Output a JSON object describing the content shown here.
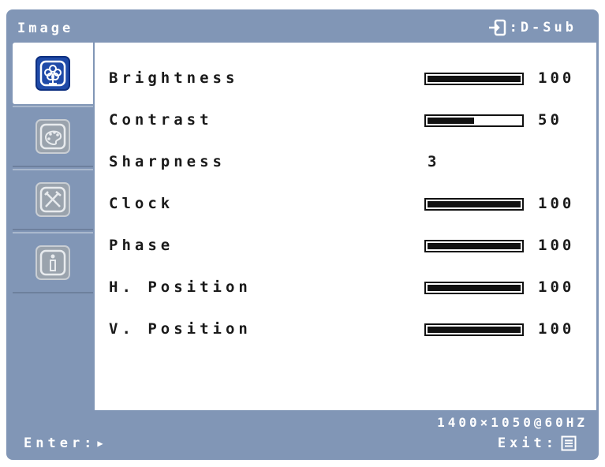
{
  "osd": {
    "title": "Image",
    "source_label": ":D-Sub",
    "resolution": "1400×1050@60HZ",
    "enter_label": "Enter:",
    "exit_label": "Exit:"
  },
  "sidebar": {
    "items": [
      {
        "icon": "image-icon",
        "active": true
      },
      {
        "icon": "palette-icon",
        "active": false
      },
      {
        "icon": "tools-icon",
        "active": false
      },
      {
        "icon": "info-icon",
        "active": false
      }
    ]
  },
  "settings": [
    {
      "label": "Brightness",
      "value": "100",
      "level": 1.0
    },
    {
      "label": "Contrast",
      "value": "50",
      "level": 0.5
    },
    {
      "label": "Sharpness",
      "value": "3"
    },
    {
      "label": "Clock",
      "value": "100",
      "level": 1.0
    },
    {
      "label": "Phase",
      "value": "100",
      "level": 1.0
    },
    {
      "label": "H. Position",
      "value": "100",
      "level": 1.0
    },
    {
      "label": "V. Position",
      "value": "100",
      "level": 1.0
    }
  ],
  "colors": {
    "panel": "#8196b6",
    "active_icon": "#1f4aa8",
    "bar": "#111111"
  }
}
